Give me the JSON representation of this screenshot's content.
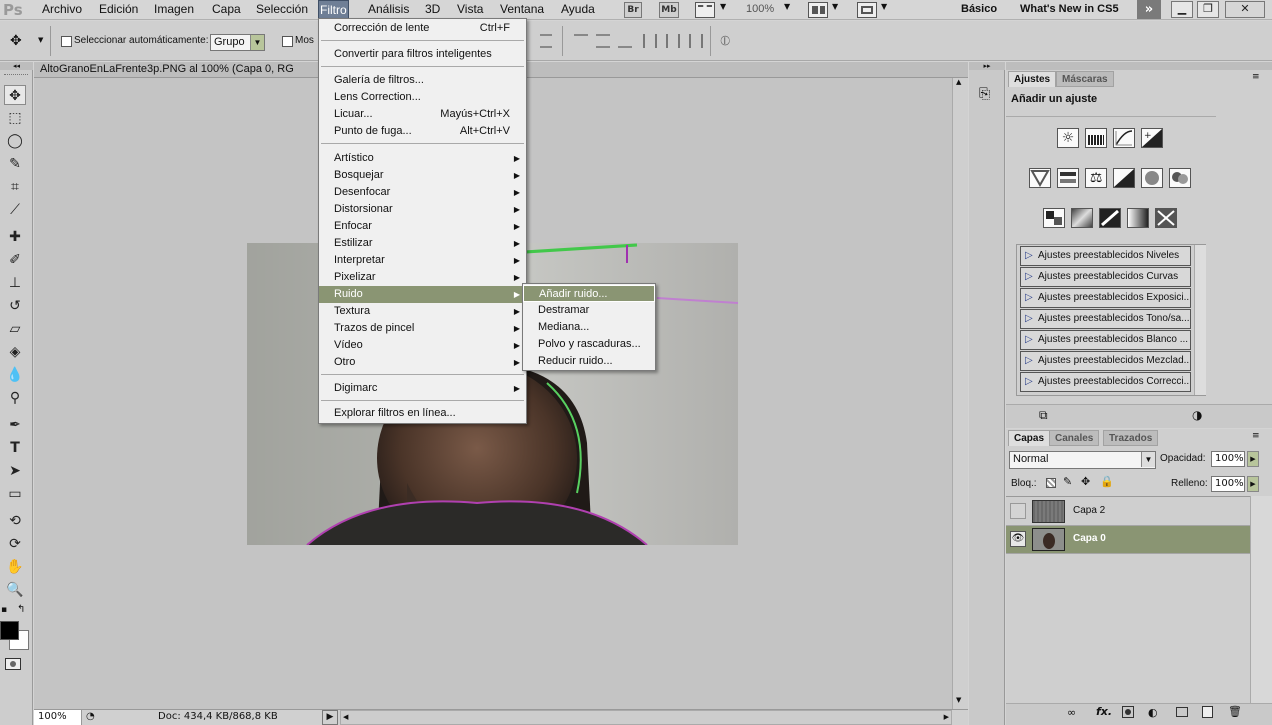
{
  "app": {
    "logo": "Ps"
  },
  "menubar": {
    "items": [
      "Archivo",
      "Edición",
      "Imagen",
      "Capa",
      "Selección",
      "Filtro",
      "Análisis",
      "3D",
      "Vista",
      "Ventana",
      "Ayuda"
    ],
    "active": "Filtro",
    "badges": {
      "bridge": "Br",
      "minibridge": "Mb"
    },
    "zoom": "100%",
    "workspace": "Básico",
    "whats_new": "What's New in CS5"
  },
  "options": {
    "auto_select_label": "Seleccionar automáticamente:",
    "auto_select_value": "Grupo",
    "show_transform_label": "Mos"
  },
  "document": {
    "title": "AltoGranoEnLaFrente3p.PNG al 100% (Capa 0, RG",
    "status_zoom": "100%",
    "status_doc": "Doc: 434,4 KB/868,8 KB"
  },
  "filter_menu": {
    "items": [
      {
        "label": "Corrección de lente",
        "shortcut": "Ctrl+F"
      },
      {
        "label": "Convertir para filtros inteligentes"
      },
      {
        "label": "Galería de filtros..."
      },
      {
        "label": "Lens Correction..."
      },
      {
        "label": "Licuar...",
        "shortcut": "Mayús+Ctrl+X"
      },
      {
        "label": "Punto de fuga...",
        "shortcut": "Alt+Ctrl+V"
      },
      {
        "label": "Artístico"
      },
      {
        "label": "Bosquejar"
      },
      {
        "label": "Desenfocar"
      },
      {
        "label": "Distorsionar"
      },
      {
        "label": "Enfocar"
      },
      {
        "label": "Estilizar"
      },
      {
        "label": "Interpretar"
      },
      {
        "label": "Pixelizar"
      },
      {
        "label": "Ruido"
      },
      {
        "label": "Textura"
      },
      {
        "label": "Trazos de pincel"
      },
      {
        "label": "Vídeo"
      },
      {
        "label": "Otro"
      },
      {
        "label": "Digimarc"
      },
      {
        "label": "Explorar filtros en línea..."
      }
    ]
  },
  "noise_submenu": {
    "items": [
      "Añadir ruido...",
      "Destramar",
      "Mediana...",
      "Polvo y rascaduras...",
      "Reducir ruido..."
    ]
  },
  "adjustments_panel": {
    "tabs": [
      "Ajustes",
      "Máscaras"
    ],
    "heading": "Añadir un ajuste",
    "presets": [
      "Ajustes preestablecidos Niveles",
      "Ajustes preestablecidos Curvas",
      "Ajustes preestablecidos Exposici...",
      "Ajustes preestablecidos Tono/sa...",
      "Ajustes preestablecidos Blanco ...",
      "Ajustes preestablecidos Mezclad...",
      "Ajustes preestablecidos Correcci..."
    ]
  },
  "layers_panel": {
    "tabs": [
      "Capas",
      "Canales",
      "Trazados"
    ],
    "blend_mode": "Normal",
    "opacity_label": "Opacidad:",
    "opacity_value": "100%",
    "lock_label": "Bloq.:",
    "fill_label": "Relleno:",
    "fill_value": "100%",
    "layers": [
      {
        "name": "Capa 2",
        "visible": false,
        "selected": false
      },
      {
        "name": "Capa 0",
        "visible": true,
        "selected": true
      }
    ]
  },
  "colors": {
    "highlight": "#8a9573",
    "menu_bg": "#f0f0f0"
  }
}
